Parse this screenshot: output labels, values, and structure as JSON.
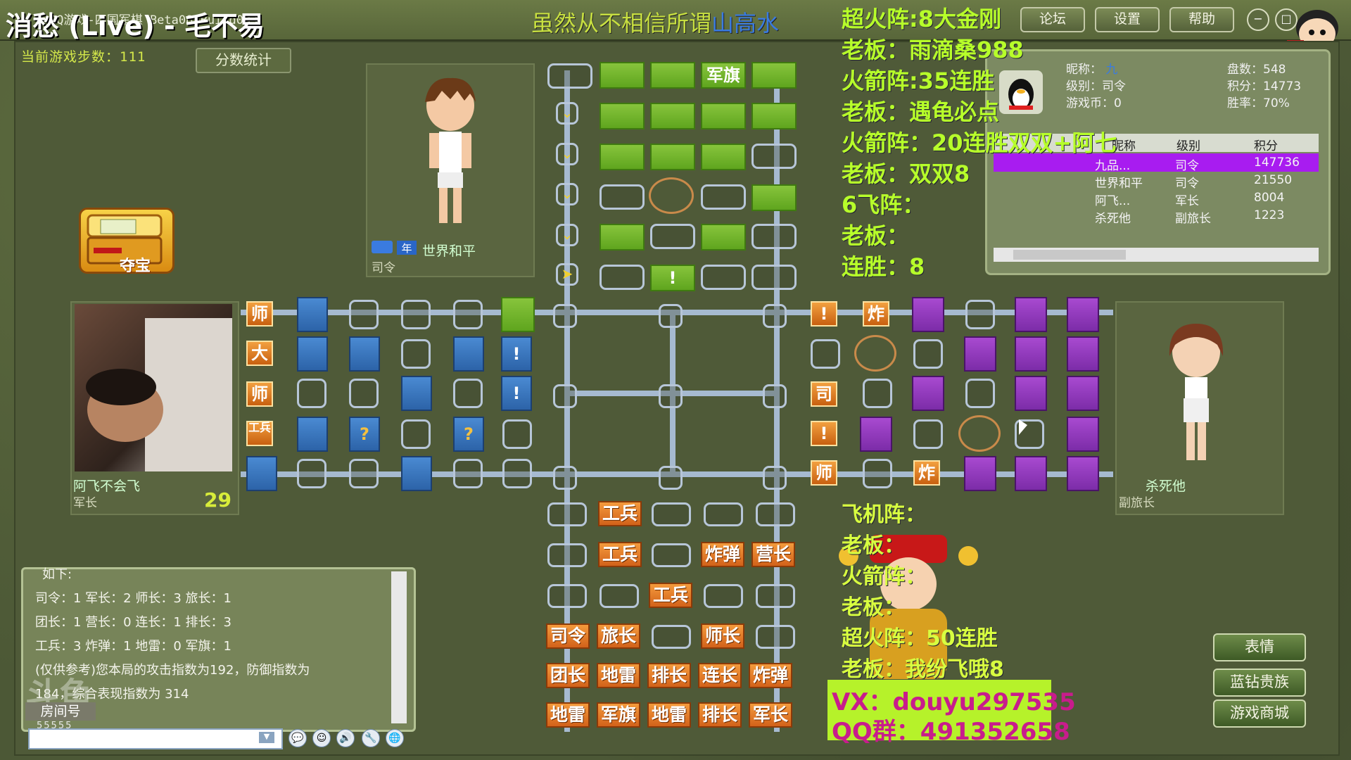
{
  "window": {
    "title_overlay": "消愁 (Live) - 毛不易",
    "title_sub": "QQ游戏-四国军棋 Beta08 Build033",
    "marquee_a": "虽然从不相信所谓",
    "marquee_b": "山高水",
    "buttons": {
      "forum": "论坛",
      "settings": "设置",
      "help": "帮助"
    }
  },
  "game": {
    "steps_label": "当前游戏步数：111",
    "score_button": "分数统计",
    "treasure_label": "夺宝"
  },
  "players": {
    "top": {
      "name": "世界和平",
      "rank": "司令"
    },
    "left": {
      "name": "阿飞不会飞",
      "rank": "军长",
      "timer": "29"
    },
    "right": {
      "name": "杀死他",
      "rank": "副旅长"
    }
  },
  "board": {
    "top_labels": {
      "flag": "军旗",
      "mark": "!"
    },
    "left_tags": [
      "师",
      "大",
      "师",
      "工兵"
    ],
    "left_marks": [
      "!",
      "!",
      "?",
      "?"
    ],
    "right_tags": [
      "!",
      "炸",
      "司",
      "!",
      "师",
      "炸"
    ],
    "bottom_pieces": [
      "工兵",
      "工兵",
      "炸弹",
      "营长",
      "工兵",
      "司令",
      "旅长",
      "师长",
      "团长",
      "地雷",
      "排长",
      "连长",
      "炸弹",
      "地雷",
      "军旗",
      "地雷",
      "排长",
      "军长"
    ]
  },
  "overlay": {
    "lines": [
      "超火阵:8大金刚",
      "老板：雨滴桑988",
      "火箭阵:35连胜",
      "老板：遇龟必点",
      "火箭阵：20连胜双双+阿七",
      "老板：双双8",
      "6飞阵：",
      "老板：",
      "连胜：8"
    ],
    "lower_lines": [
      "飞机阵：",
      "老板：",
      "火箭阵：",
      "老板：",
      "超火阵：50连胜",
      "老板：我纷飞哦8"
    ],
    "promo_vx": "VX：douyu297535",
    "promo_qq": "QQ群：491352658"
  },
  "info_panel": {
    "nickname_label": "昵称：",
    "nickname_value": "九",
    "level_label": "级别：司令",
    "coins_label": "游戏币：0",
    "games_label": "盘数：548",
    "points_label": "积分：14773",
    "winrate_label": "胜率：70%",
    "table_headers": [
      "昵称",
      "级别",
      "积分"
    ],
    "rows": [
      {
        "name": "九品...",
        "rank": "司令",
        "score": "147736"
      },
      {
        "name": "世界和平",
        "rank": "司令",
        "score": "21550"
      },
      {
        "name": "阿飞...",
        "rank": "军长",
        "score": "8004"
      },
      {
        "name": "杀死他",
        "rank": "副旅长",
        "score": "1223"
      }
    ]
  },
  "chat": {
    "lines": [
      "如下:",
      "司令：1 军长：2 师长：3 旅长：1",
      "团长：1 营长：0 连长：1 排长：3",
      "工兵：3 炸弹：1 地雷：0 军旗：1",
      "(仅供参考)您本局的攻击指数为192，防御指数为",
      "184，综合表现指数为 314"
    ],
    "room_label": "房间号",
    "room_value": "55555"
  },
  "side_buttons": [
    "表情",
    "蓝钻贵族",
    "游戏商城"
  ],
  "colors": {
    "overlay_green": "#b7ff2a",
    "promo_bg": "#b6f22a",
    "promo_text": "#c81c8c",
    "highlight_row": "#a81cf0"
  }
}
